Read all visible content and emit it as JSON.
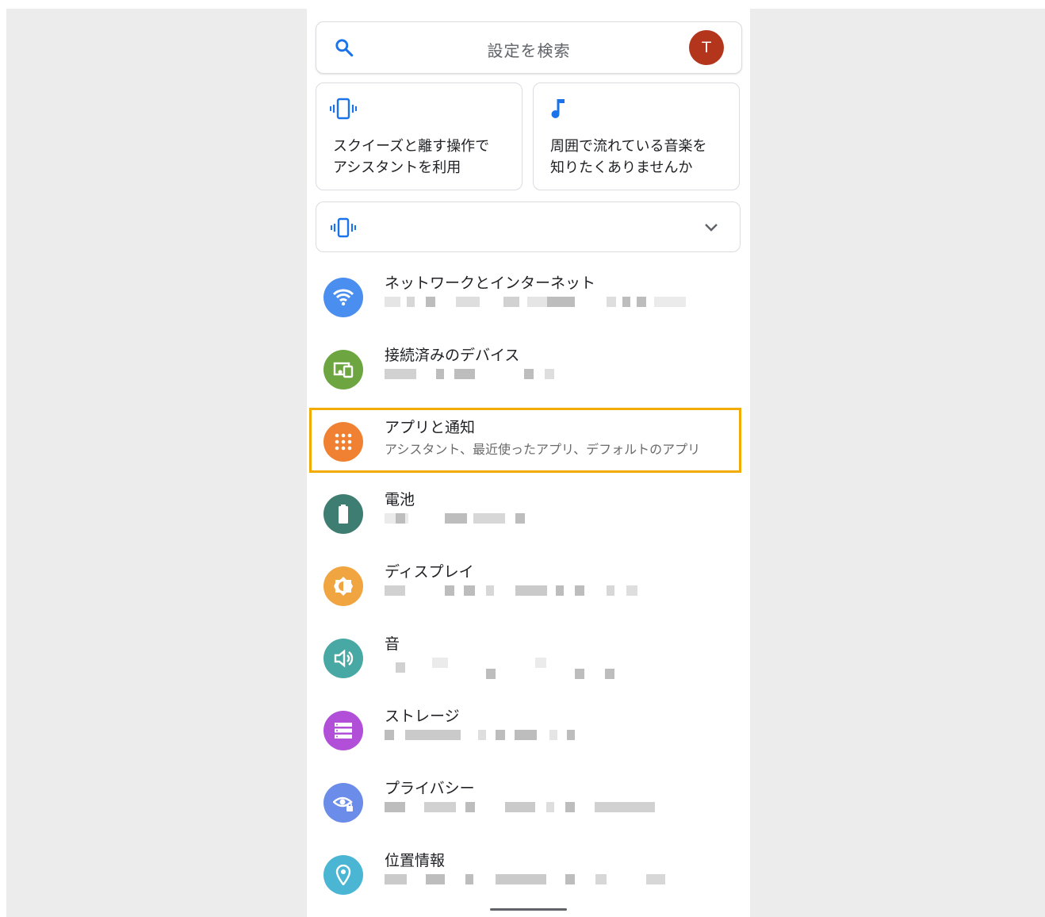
{
  "search": {
    "placeholder": "設定を検索",
    "avatar_letter": "T",
    "icon": "search-icon"
  },
  "suggestions": [
    {
      "icon": "vibration-icon",
      "text": "スクイーズと離す操作で\nアシスタントを利用"
    },
    {
      "icon": "music-note-icon",
      "text": "周囲で流れている音楽を\n知りたくありませんか"
    }
  ],
  "collapsed_card": {
    "icon": "vibration-icon",
    "expand_icon": "chevron-down-icon"
  },
  "settings": [
    {
      "title": "ネットワークとインターネット",
      "icon": "wifi-icon",
      "color": "#4a8ef0"
    },
    {
      "title": "接続済みのデバイス",
      "icon": "devices-icon",
      "color": "#6da641"
    },
    {
      "title": "アプリと通知",
      "subtitle": "アシスタント、最近使ったアプリ、デフォルトのアプリ",
      "icon": "apps-grid-icon",
      "color": "#f08132"
    },
    {
      "title": "電池",
      "icon": "battery-icon",
      "color": "#3e7d72"
    },
    {
      "title": "ディスプレイ",
      "icon": "brightness-icon",
      "color": "#f0a540"
    },
    {
      "title": "音",
      "icon": "volume-icon",
      "color": "#48a8a4"
    },
    {
      "title": "ストレージ",
      "icon": "storage-icon",
      "color": "#b24fd8"
    },
    {
      "title": "プライバシー",
      "icon": "privacy-icon",
      "color": "#6b8ce8"
    },
    {
      "title": "位置情報",
      "icon": "location-icon",
      "color": "#4ab6d4"
    }
  ],
  "colors": {
    "accent_blue": "#1a73e8",
    "highlight": "#f2ab00"
  }
}
